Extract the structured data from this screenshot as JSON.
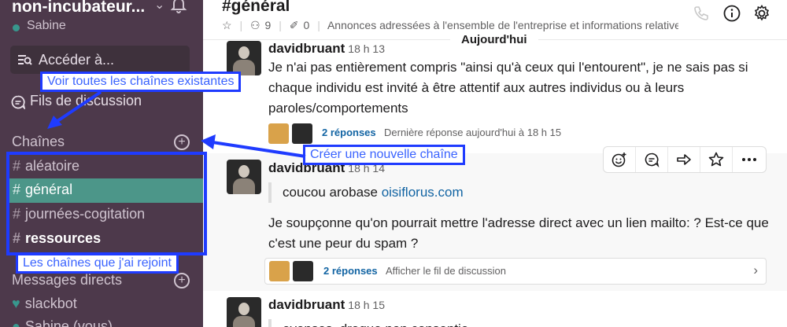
{
  "sidebar": {
    "workspace": "non-incubateur...",
    "user": "Sabine",
    "jump_to": "Accéder à...",
    "threads": "Fils de discussion",
    "channels_header": "Chaînes",
    "channels": [
      {
        "name": "aléatoire",
        "active": false,
        "bold": false
      },
      {
        "name": "général",
        "active": true,
        "bold": false
      },
      {
        "name": "journées-cogitation",
        "active": false,
        "bold": false
      },
      {
        "name": "ressources",
        "active": false,
        "bold": true
      }
    ],
    "hash": "#",
    "dm_header": "Messages directs",
    "dms": [
      "slackbot",
      "Sabine (vous)"
    ]
  },
  "channel": {
    "title": "#général",
    "members": "9",
    "pinned": "0",
    "topic": "Annonces adressées à l'ensemble de l'entreprise et informations relatives au travail"
  },
  "date_divider": "Aujourd'hui",
  "messages": [
    {
      "author": "davidbruant",
      "time": "18 h 13",
      "text": "Je n'ai pas entièrement compris \"ainsi qu'à ceux qui l'entourent\", je ne sais pas si chaque individu est invité à être attentif aux autres individus ou à leurs paroles/comportements",
      "replies": "2 réponses",
      "last_reply": "Dernière réponse aujourd'hui à 18 h 15"
    },
    {
      "author": "davidbruant",
      "time": "18 h 14",
      "quote_prefix": "coucou arobase ",
      "quote_link": "oisiflorus.com",
      "text": "Je soupçonne qu'on pourrait mettre l'adresse direct avec un lien mailto: ? Est-ce que c'est une peur du spam ?",
      "replies": "2 réponses",
      "view_thread": "Afficher le fil de discussion"
    },
    {
      "author": "davidbruant",
      "time": "18 h 15",
      "quote_text": "evenses, drague non consentie"
    }
  ],
  "annotations": {
    "all_channels": "Voir toutes les chaînes existantes",
    "new_channel": "Créer une nouvelle chaîne",
    "joined": "Les chaînes que j'ai rejoint"
  },
  "colors": {
    "sidebar_bg": "#4d394b",
    "active_channel": "#4c9689",
    "annotation": "#1f3bff",
    "link": "#1264a3"
  }
}
